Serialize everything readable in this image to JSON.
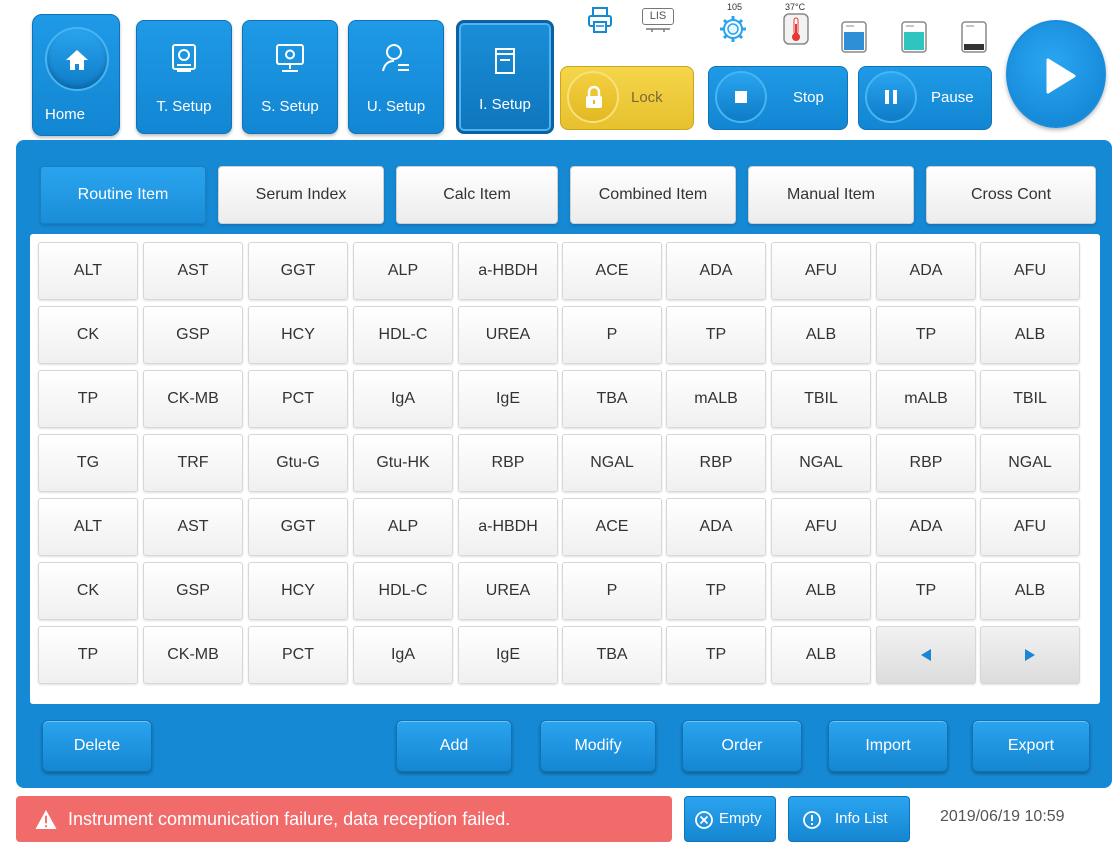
{
  "nav": {
    "home": "Home",
    "t_setup": "T. Setup",
    "s_setup": "S. Setup",
    "u_setup": "U. Setup",
    "i_setup": "I. Setup"
  },
  "status": {
    "lis": "LIS",
    "count": "105",
    "temperature": "37°C"
  },
  "controls": {
    "lock": "Lock",
    "stop": "Stop",
    "pause": "Pause"
  },
  "tabs": [
    "Routine Item",
    "Serum Index",
    "Calc Item",
    "Combined Item",
    "Manual Item",
    "Cross Cont"
  ],
  "grid": [
    [
      "ALT",
      "AST",
      "GGT",
      "ALP",
      "a-HBDH",
      "ACE",
      "ADA",
      "AFU",
      "ADA",
      "AFU"
    ],
    [
      "CK",
      "GSP",
      "HCY",
      "HDL-C",
      "UREA",
      "P",
      "TP",
      "ALB",
      "TP",
      "ALB"
    ],
    [
      "TP",
      "CK-MB",
      "PCT",
      "IgA",
      "IgE",
      "TBA",
      "mALB",
      "TBIL",
      "mALB",
      "TBIL"
    ],
    [
      "TG",
      "TRF",
      "Gtu-G",
      "Gtu-HK",
      "RBP",
      "NGAL",
      "RBP",
      "NGAL",
      "RBP",
      "NGAL"
    ],
    [
      "ALT",
      "AST",
      "GGT",
      "ALP",
      "a-HBDH",
      "ACE",
      "ADA",
      "AFU",
      "ADA",
      "AFU"
    ],
    [
      "CK",
      "GSP",
      "HCY",
      "HDL-C",
      "UREA",
      "P",
      "TP",
      "ALB",
      "TP",
      "ALB"
    ],
    [
      "TP",
      "CK-MB",
      "PCT",
      "IgA",
      "IgE",
      "TBA",
      "TP",
      "ALB"
    ]
  ],
  "actions": {
    "delete": "Delete",
    "add": "Add",
    "modify": "Modify",
    "order": "Order",
    "import": "Import",
    "export": "Export"
  },
  "statusbar": {
    "alarm": "Instrument communication failure, data reception failed.",
    "empty": "Empty",
    "info_list": "Info List",
    "datetime": "2019/06/19 10:59"
  },
  "colors": {
    "primary": "#1689d4",
    "lock": "#f0cf3f",
    "alarm": "#f26b6b"
  }
}
